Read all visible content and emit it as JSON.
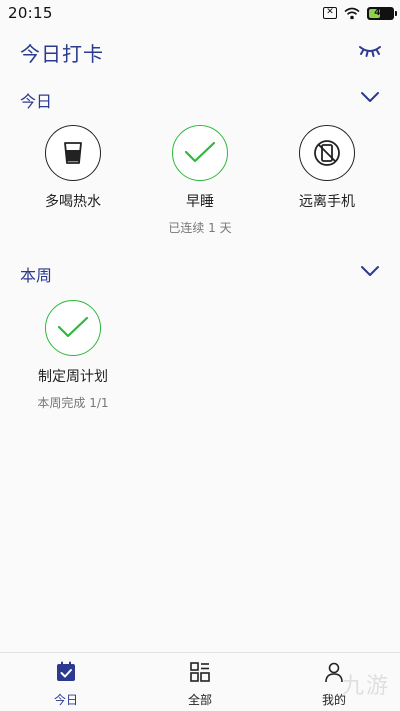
{
  "status_bar": {
    "time": "20:15",
    "box_icon_text": "✕",
    "battery_level": "49",
    "battery_fraction": 0.49
  },
  "header": {
    "title": "今日打卡",
    "eye_icon": "eye-closed-icon"
  },
  "sections": {
    "today": {
      "title": "今日",
      "habits": [
        {
          "label": "多喝热水",
          "icon": "cup-icon",
          "done": false,
          "sub": ""
        },
        {
          "label": "早睡",
          "icon": "check-icon",
          "done": true,
          "sub": "已连续 1 天"
        },
        {
          "label": "远离手机",
          "icon": "no-phone-icon",
          "done": false,
          "sub": ""
        }
      ]
    },
    "week": {
      "title": "本周",
      "habits": [
        {
          "label": "制定周计划",
          "icon": "check-icon",
          "done": true,
          "sub": "本周完成 1/1"
        }
      ]
    }
  },
  "bottom_nav": {
    "items": [
      {
        "label": "今日",
        "icon": "calendar-check-icon",
        "active": true
      },
      {
        "label": "全部",
        "icon": "grid-icon",
        "active": false
      },
      {
        "label": "我的",
        "icon": "user-icon",
        "active": false
      }
    ]
  },
  "watermark": {
    "text": "九游"
  },
  "colors": {
    "accent": "#2b3a8f",
    "done_green": "#2db83d",
    "text": "#222222",
    "subtext": "#777777",
    "background": "#fafafa"
  }
}
